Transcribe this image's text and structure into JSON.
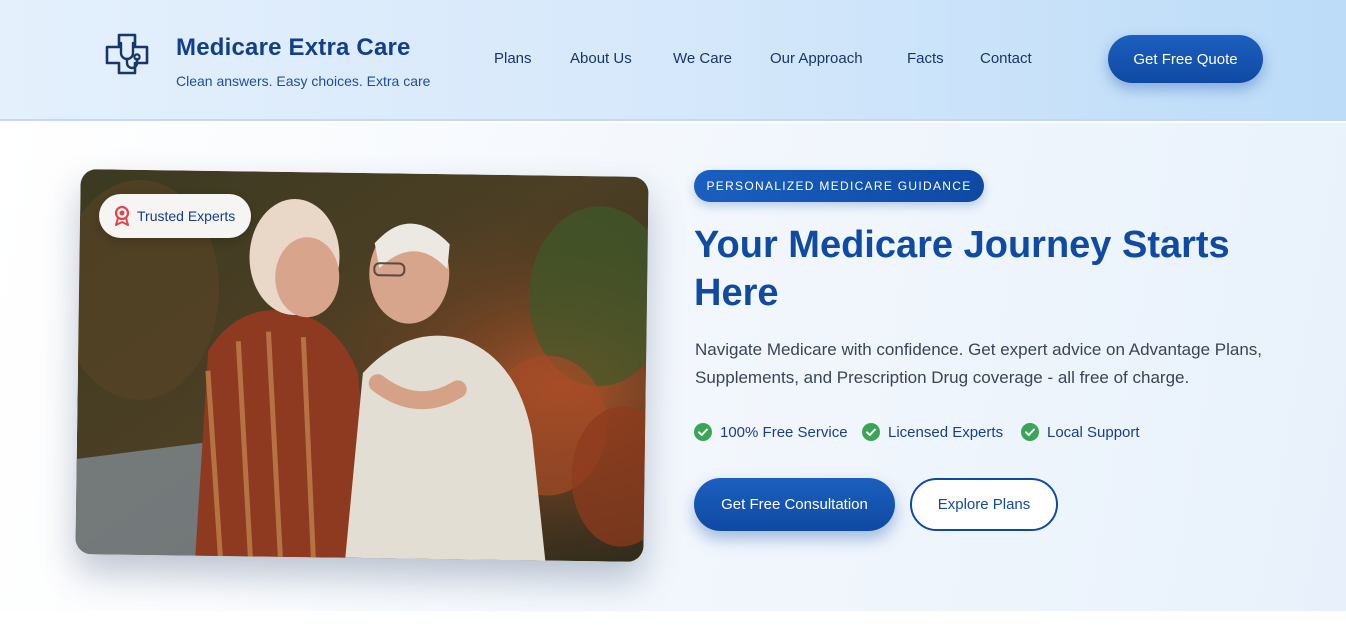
{
  "brand": {
    "title": "Medicare Extra Care",
    "tagline": "Clean answers. Easy choices. Extra care",
    "logo_icon": "medical-cross-stethoscope-icon"
  },
  "nav": {
    "items": [
      {
        "label": "Plans"
      },
      {
        "label": "About Us"
      },
      {
        "label": "We Care"
      },
      {
        "label": "Our Approach"
      },
      {
        "label": "Facts"
      },
      {
        "label": "Contact"
      }
    ],
    "cta_label": "Get Free Quote"
  },
  "hero": {
    "badge_label": "Trusted Experts",
    "badge_icon": "award-ribbon-icon",
    "photo_alt": "elderly-couple-photo",
    "eyebrow": "PERSONALIZED MEDICARE GUIDANCE",
    "headline": "Your Medicare Journey Starts Here",
    "description": "Navigate Medicare with confidence. Get expert advice on Advantage Plans, Supplements, and Prescription Drug coverage - all free of charge.",
    "features": [
      {
        "label": "100% Free Service",
        "icon": "check-circle-icon"
      },
      {
        "label": "Licensed Experts",
        "icon": "check-circle-icon"
      },
      {
        "label": "Local Support",
        "icon": "check-circle-icon"
      }
    ],
    "primary_cta": "Get Free Consultation",
    "secondary_cta": "Explore Plans"
  },
  "colors": {
    "brand_blue": "#0f4aa3",
    "check_green": "#3aa655",
    "badge_red": "#e0454a"
  }
}
